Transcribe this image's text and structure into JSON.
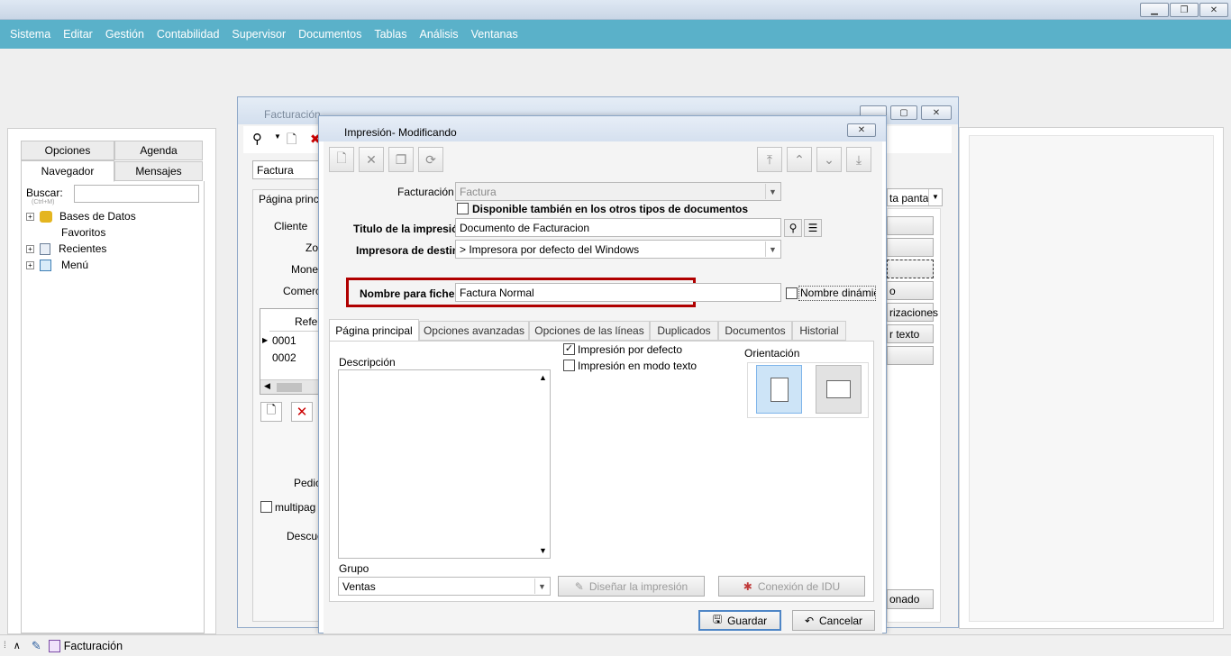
{
  "menubar": {
    "items": [
      "Sistema",
      "Editar",
      "Gestión",
      "Contabilidad",
      "Supervisor",
      "Documentos",
      "Tablas",
      "Análisis",
      "Ventanas"
    ]
  },
  "navigator": {
    "tabs": [
      "Opciones",
      "Agenda",
      "Navegador",
      "Mensajes"
    ],
    "search_label": "Buscar:",
    "search_hint": "(Ctrl+M)",
    "search_value": "",
    "tree": [
      "Bases de Datos",
      "Favoritos",
      "Recientes",
      "Menú"
    ]
  },
  "bgwindow": {
    "title": "Facturación",
    "doc_type": "Factura",
    "tab": "Página princ",
    "labels": [
      "Cliente",
      "Zo",
      "Mone",
      "Comerc"
    ],
    "grid_header": "Refer",
    "rows": [
      "0001",
      "0002"
    ],
    "bottom_labels": [
      "Pedic",
      "multipag",
      "Descue"
    ],
    "right_frag": [
      "ta panta",
      "o",
      "rizaciones",
      "r texto",
      "onado"
    ]
  },
  "dialog": {
    "title": "Impresión- Modificando",
    "facturacion_label": "Facturación",
    "facturacion_value": "Factura",
    "disponible_label": "Disponible también en los otros tipos de documentos",
    "titulo_label": "Titulo de la impresión",
    "titulo_value": "Documento de Facturacion",
    "impresora_label": "Impresora de destino",
    "impresora_value": "> Impresora por defecto del Windows",
    "nombre_label": "Nombre para fichero",
    "nombre_value": "Factura  Normal",
    "nombre_dinamico_label": "Nombre dinámic",
    "tabs": [
      "Página principal",
      "Opciones avanzadas",
      "Opciones de las líneas",
      "Duplicados",
      "Documentos",
      "Historial"
    ],
    "impresion_defecto_label": "Impresión por defecto",
    "impresion_texto_label": "Impresión en modo texto",
    "orientacion_label": "Orientación",
    "descripcion_label": "Descripción",
    "descripcion_value": "",
    "grupo_label": "Grupo",
    "grupo_value": "Ventas",
    "disenar_label": "Diseñar la impresión",
    "conexion_label": "Conexión de IDU",
    "guardar_label": "Guardar",
    "cancelar_label": "Cancelar"
  },
  "statusbar": {
    "task": "Facturación"
  },
  "colors": {
    "menubar": "#5ab1c9",
    "highlight": "#b00000",
    "accent": "#4f86c6"
  }
}
